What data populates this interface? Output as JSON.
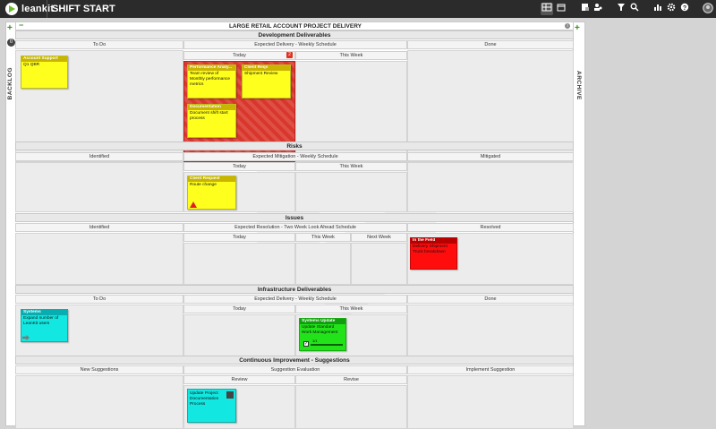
{
  "app": {
    "brand": "leankit",
    "board_name": "SHIFT START"
  },
  "toolbar": {
    "icons": [
      "board-view-icon",
      "calendar-icon",
      "edit-card-icon",
      "users-icon",
      "filter-icon",
      "search-icon",
      "analytics-icon",
      "settings-icon",
      "help-icon",
      "avatar"
    ]
  },
  "backlog": {
    "label": "BACKLOG",
    "count": "0",
    "add": "+"
  },
  "archive": {
    "label": "ARCHIVE",
    "add": "+"
  },
  "board": {
    "title": "LARGE RETAIL ACCOUNT PROJECT DELIVERY",
    "collapse": "−",
    "info": "i"
  },
  "lanes": {
    "dev": {
      "name": "Development Deliverables",
      "todo": "To Do",
      "expected": "Expected Delivery - Weekly Schedule",
      "today": "Today",
      "this_week": "This Week",
      "done": "Done",
      "wip": "2"
    },
    "risks": {
      "name": "Risks",
      "identified": "Identified",
      "expected": "Expected Mitigation - Weekly Schedule",
      "today": "Today",
      "this_week": "This Week",
      "mitigated": "Mitigated"
    },
    "issues": {
      "name": "Issues",
      "identified": "Identified",
      "expected": "Expected Resolution - Two Week Look Ahead Schedule",
      "today": "Today",
      "this_week": "This Week",
      "next_week": "Next Week",
      "resolved": "Resolved"
    },
    "infra": {
      "name": "Infrastructure Deliverables",
      "todo": "To Do",
      "expected": "Expected Delivery - Weekly Schedule",
      "today": "Today",
      "this_week": "This Week",
      "done": "Done"
    },
    "ci": {
      "name": "Continuous Improvement - Suggestions",
      "new": "New Suggestions",
      "eval": "Suggestion Evaluation",
      "review": "Review",
      "revise": "Revise",
      "implement": "Implement Suggestion"
    }
  },
  "cards": {
    "account_support": {
      "type": "Account Support",
      "title": "Q1 QBR",
      "color": "#ffff1e"
    },
    "perf_analysis": {
      "type": "Performance Analy...",
      "title": "Team review of Monthly performance metrics",
      "color": "#ffff1e"
    },
    "client_reqs": {
      "type": "Client Reqs",
      "title": "Shipment Review",
      "color": "#ffff1e"
    },
    "documentation": {
      "type": "Documentation",
      "title": "Document shift start process",
      "color": "#ffff1e"
    },
    "client_request": {
      "type": "Client Request",
      "title": "Route change",
      "color": "#ffff1e"
    },
    "in_the_field": {
      "type": "In the Field",
      "title": "Delivery Shipment Truck breakdown",
      "color": "#ff0d0d"
    },
    "systems": {
      "type": "Systems",
      "title": "Expand number of LeanKit users",
      "color": "#12e8e1"
    },
    "systems_update": {
      "type": "Systems Update",
      "title": "Update Standard Work Management",
      "color": "#22e31a",
      "progress": "1/1"
    },
    "update_project": {
      "title": "Update Project Documentation Process",
      "color": "#12e8e1"
    }
  }
}
